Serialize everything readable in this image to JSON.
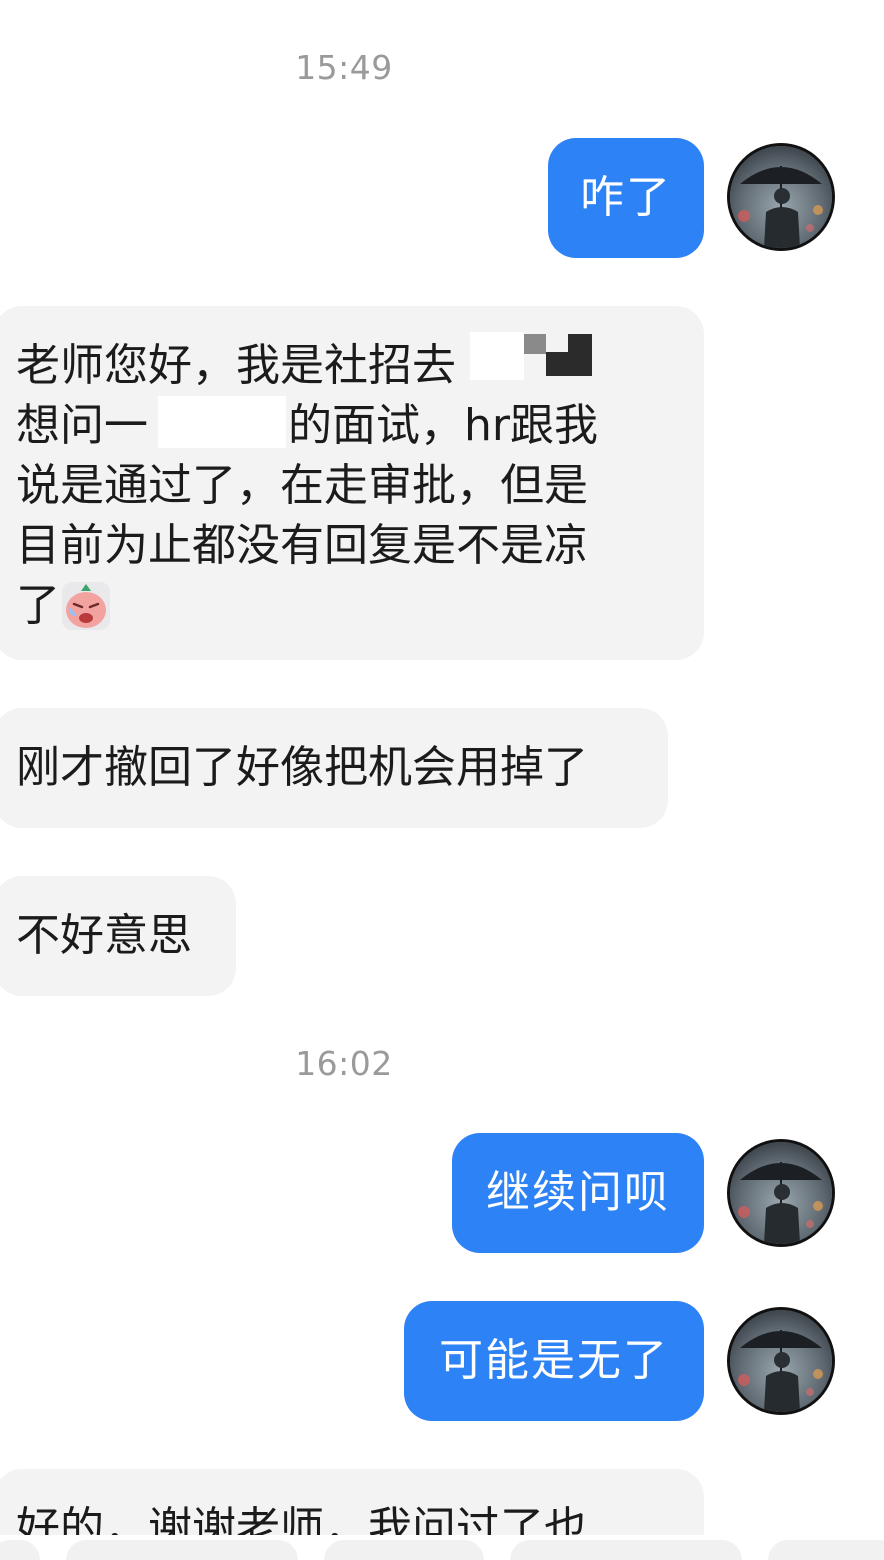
{
  "timestamps": [
    "15:49",
    "16:02"
  ],
  "messages": {
    "m1": "咋了",
    "m2_l1": "老师您好，我是社招去",
    "m2_l2a": "想问一",
    "m2_l2b": "的面试，hr跟我",
    "m2_l3": "说是通过了，在走审批，但是",
    "m2_l4": "目前为止都没有回复是不是凉",
    "m2_l5": "了",
    "m3": "刚才撤回了好像把机会用掉了",
    "m4": "不好意思",
    "m5": "继续问呗",
    "m6": "可能是无了",
    "m7": "好的，谢谢老师，我问过了也"
  },
  "emoji": {
    "m2": "crying-face-emoji"
  },
  "avatar": {
    "icon": "man-with-umbrella-avatar"
  },
  "colors": {
    "outgoing_bubble": "#2d82f6",
    "incoming_bubble": "#f3f3f3",
    "timestamp": "#9a9a9a"
  }
}
